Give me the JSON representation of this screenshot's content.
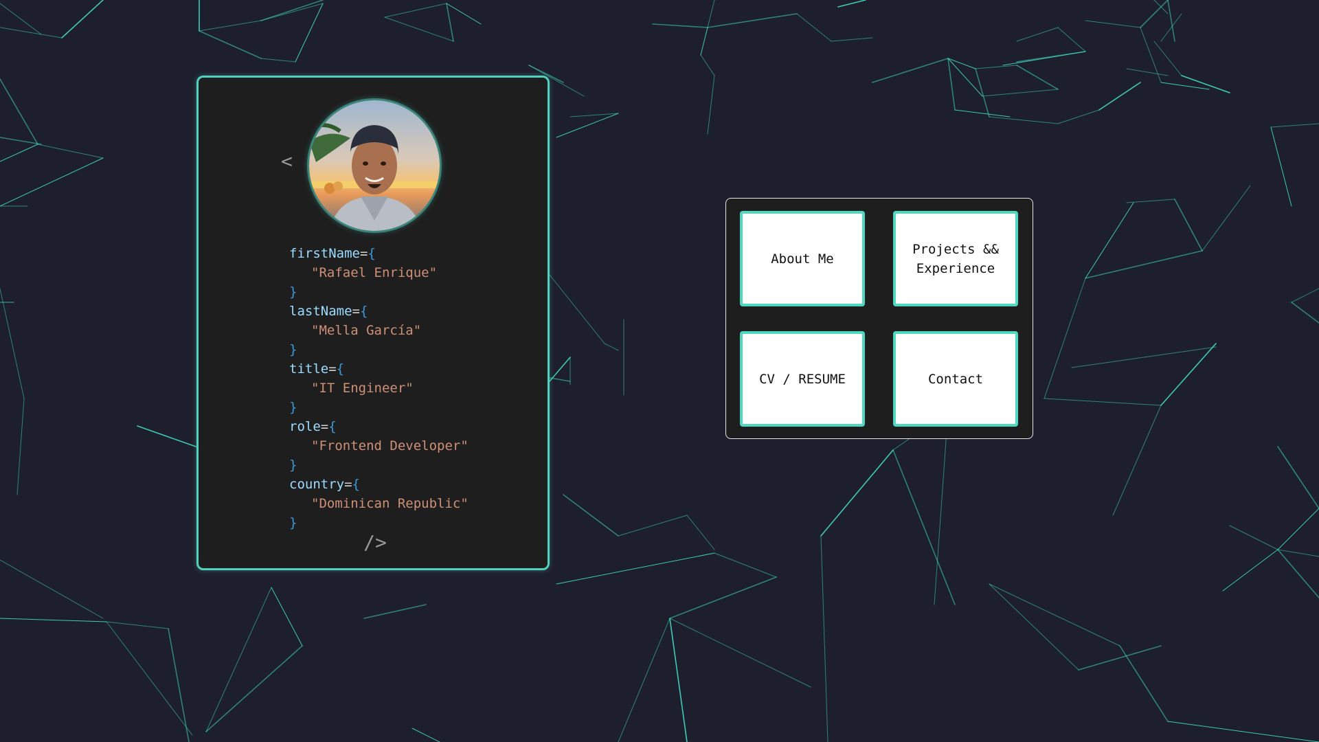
{
  "theme": {
    "background": "#1e1f2c",
    "accent": "#4fd3be",
    "card_background": "#1e1e1e",
    "button_background": "#ffffff"
  },
  "profile_card": {
    "open_tag": "<",
    "close_tag": "/>",
    "avatar_icon": "avatar-photo",
    "fields": [
      {
        "key": "firstName",
        "value": "\"Rafael Enrique\""
      },
      {
        "key": "lastName",
        "value": "\"Mella García\""
      },
      {
        "key": "title",
        "value": "\"IT Engineer\""
      },
      {
        "key": "role",
        "value": "\"Frontend Developer\""
      },
      {
        "key": "country",
        "value": "\"Dominican Republic\""
      }
    ],
    "equals_brace": "=",
    "open_brace": "{",
    "close_brace": "}"
  },
  "nav": {
    "items": [
      {
        "label": "About Me"
      },
      {
        "label": "Projects && Experience"
      },
      {
        "label": "CV / RESUME"
      },
      {
        "label": "Contact"
      }
    ]
  }
}
